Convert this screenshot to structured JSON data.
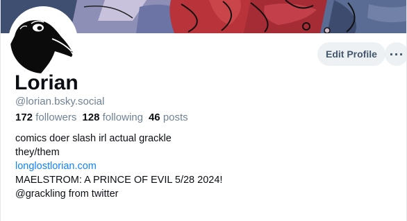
{
  "profile": {
    "display_name": "Lorian",
    "handle": "@lorian.bsky.social",
    "stats": {
      "followers_count": "172",
      "followers_label": "followers",
      "following_count": "128",
      "following_label": "following",
      "posts_count": "46",
      "posts_label": "posts"
    },
    "bio": {
      "line1": "comics doer slash irl actual grackle",
      "line2": "they/them",
      "link": "longlostlorian.com",
      "line4": "MAELSTROM: A PRINCE OF EVIL 5/28 2024!",
      "line5": "@grackling from twitter"
    }
  },
  "actions": {
    "edit_profile_label": "Edit Profile",
    "more_label": "···"
  },
  "icons": {
    "avatar": "crow-avatar-icon",
    "more": "ellipsis-icon"
  },
  "colors": {
    "link": "#1083fe",
    "muted": "#6f8294",
    "button_bg": "#eef1f4",
    "banner_red": "#b8333a",
    "banner_blue": "#4a5f86"
  }
}
